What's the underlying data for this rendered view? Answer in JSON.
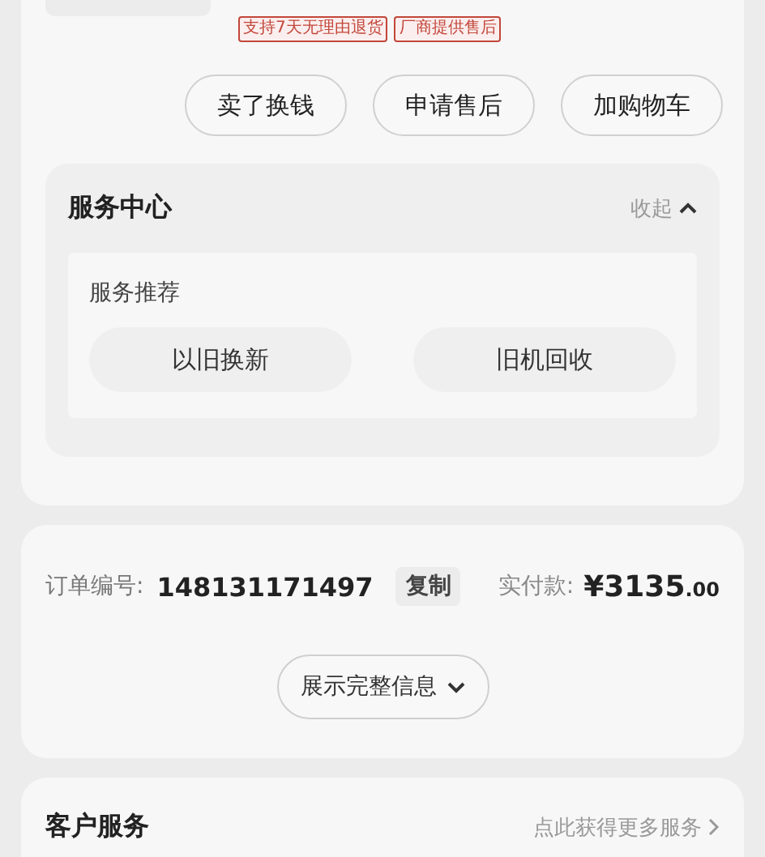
{
  "product": {
    "tags": [
      "支持7天无理由退货",
      "厂商提供售后"
    ],
    "actions": [
      "卖了换钱",
      "申请售后",
      "加购物车"
    ]
  },
  "service_center": {
    "title": "服务中心",
    "toggle": "收起",
    "expanded": true,
    "section_title": "服务推荐",
    "services": [
      "以旧换新",
      "旧机回收"
    ]
  },
  "order": {
    "number_label": "订单编号:",
    "number": "148131171497",
    "copy": "复制",
    "paid_label": "实付款:",
    "paid_currency": "¥",
    "paid_integer": "3135",
    "paid_decimal": ".00",
    "expand_button": "展示完整信息"
  },
  "customer_service": {
    "title": "客户服务",
    "link": "点此获得更多服务"
  }
}
